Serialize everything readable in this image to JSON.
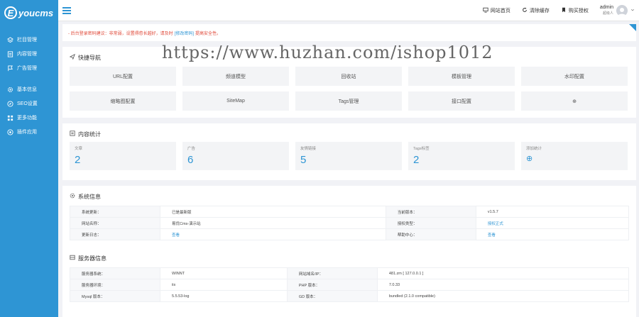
{
  "brand": {
    "logo_letter": "E",
    "logo_text": "youcms"
  },
  "sidebar": {
    "items": [
      {
        "label": "栏目管理",
        "icon": "layers-icon"
      },
      {
        "label": "内容管理",
        "icon": "doc-icon"
      },
      {
        "label": "广告管理",
        "icon": "flag-icon"
      },
      {
        "label": "基本信息",
        "icon": "gear-icon"
      },
      {
        "label": "SEO设置",
        "icon": "compass-icon"
      },
      {
        "label": "更多功能",
        "icon": "grid-icon"
      },
      {
        "label": "插件应用",
        "icon": "plugin-icon"
      }
    ]
  },
  "topbar": {
    "links": [
      {
        "label": "网站首页",
        "icon": "monitor-icon"
      },
      {
        "label": "清除缓存",
        "icon": "refresh-icon"
      },
      {
        "label": "购买授权",
        "icon": "bookmark-icon"
      }
    ],
    "user_name": "admin",
    "user_role": "超级人"
  },
  "alert": {
    "before": "- 后台登录密码建议：非常弱，设置得愈长越好，请及时",
    "link": "[修改密码]",
    "after": "提高安全性。"
  },
  "watermark": "https://www.huzhan.com/ishop1012",
  "quick_nav": {
    "title": "快捷导航",
    "items": [
      "URL配置",
      "频道模型",
      "回收站",
      "模板管理",
      "水印配置",
      "缩略图配置",
      "SiteMap",
      "Tags管理",
      "接口配置",
      "⊕"
    ]
  },
  "stats": {
    "title": "内容统计",
    "cards": [
      {
        "label": "文章",
        "value": "2"
      },
      {
        "label": "广告",
        "value": "6"
      },
      {
        "label": "友情链接",
        "value": "5"
      },
      {
        "label": "Tags标签",
        "value": "2"
      },
      {
        "label": "添加统计",
        "value": "⊕"
      }
    ]
  },
  "system": {
    "title": "系统信息",
    "rows": [
      [
        "系统更新：",
        "已是最新版",
        "当前版本：",
        "v1.5.7"
      ],
      [
        "网站名称：",
        "易优Cms-演示站",
        "授权类型：",
        "授权正式"
      ],
      [
        "更新日志：",
        "查看",
        "帮助中心：",
        "查看"
      ]
    ]
  },
  "server": {
    "title": "服务器信息",
    "rows": [
      [
        "服务器系统：",
        "WINNT",
        "网站域名/IP：",
        "481.zm [ 127.0.0.1 ]"
      ],
      [
        "服务器环境：",
        "iis",
        "PHP 版本：",
        "7.0.33"
      ],
      [
        "Mysql 版本：",
        "5.5.53-log",
        "GD 版本：",
        "bundled (2.1.0 compatible)"
      ]
    ]
  },
  "colors": {
    "accent": "#2e95d4",
    "alert": "#e04a3a"
  }
}
